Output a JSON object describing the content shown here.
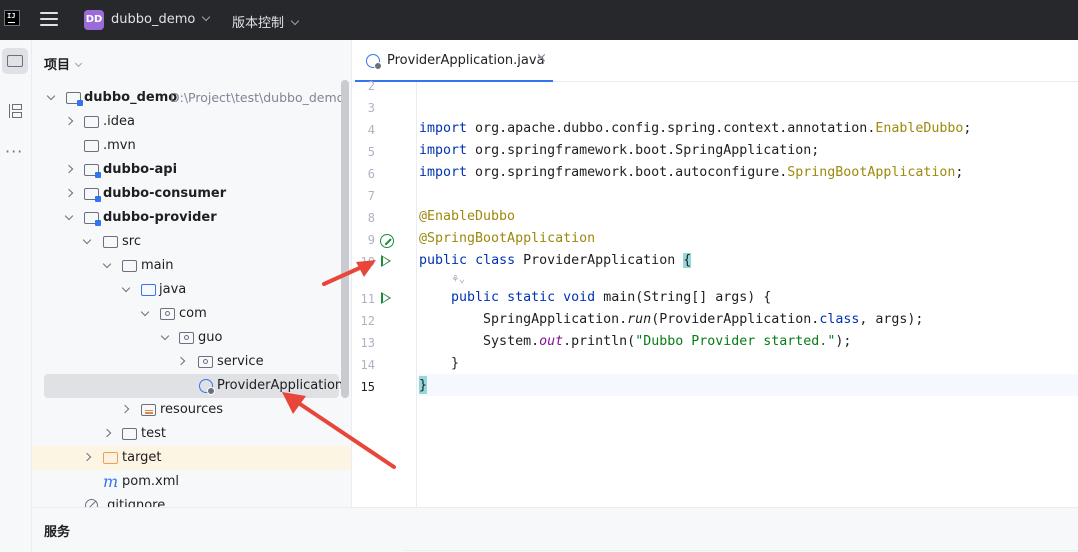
{
  "titlebar": {
    "project_badge": "DD",
    "project_name": "dubbo_demo",
    "vcs_label": "版本控制"
  },
  "project_panel": {
    "header": "项目",
    "tree": [
      {
        "label": "dubbo_demo",
        "hint": "D:\\Project\\test\\dubbo_demo"
      },
      {
        "label": ".idea"
      },
      {
        "label": ".mvn"
      },
      {
        "label": "dubbo-api"
      },
      {
        "label": "dubbo-consumer"
      },
      {
        "label": "dubbo-provider"
      },
      {
        "label": "src"
      },
      {
        "label": "main"
      },
      {
        "label": "java"
      },
      {
        "label": "com"
      },
      {
        "label": "guo"
      },
      {
        "label": "service"
      },
      {
        "label": "ProviderApplication"
      },
      {
        "label": "resources"
      },
      {
        "label": "test"
      },
      {
        "label": "target"
      },
      {
        "label": "pom.xml"
      },
      {
        "label": ".gitignore"
      }
    ]
  },
  "editor": {
    "tab_label": "ProviderApplication.java",
    "tab_close": "×",
    "line_numbers": [
      "2",
      "3",
      "4",
      "5",
      "6",
      "7",
      "8",
      "9",
      "10",
      "11",
      "12",
      "13",
      "14",
      "15"
    ],
    "inlay_hint": "⚘⌄",
    "code": {
      "l4": {
        "kw": "import",
        "pkg": " org.apache.dubbo.config.spring.context.annotation.",
        "cls": "EnableDubbo",
        "end": ";"
      },
      "l5": {
        "kw": "import",
        "rest": " org.springframework.boot.SpringApplication;"
      },
      "l6": {
        "kw": "import",
        "pkg": " org.springframework.boot.autoconfigure.",
        "cls": "SpringBootApplication",
        "end": ";"
      },
      "l8": "@EnableDubbo",
      "l9": "@SpringBootApplication",
      "l10": {
        "kw1": "public",
        "kw2": "class",
        "name": " ProviderApplication ",
        "brace": "{"
      },
      "l11": {
        "kw1": "public",
        "kw2": "static",
        "kw3": "void",
        "rest": " main(String[] args) {"
      },
      "l12": {
        "start": "SpringApplication.",
        "method": "run",
        "mid": "(ProviderApplication.",
        "kw": "class",
        "end": ", args);"
      },
      "l13": {
        "start": "System.",
        "field": "out",
        "mid": ".println(",
        "str": "\"Dubbo Provider started.\"",
        "end": ");"
      },
      "l14": "}",
      "l15": "}"
    }
  },
  "services_bar": {
    "label": "服务"
  }
}
